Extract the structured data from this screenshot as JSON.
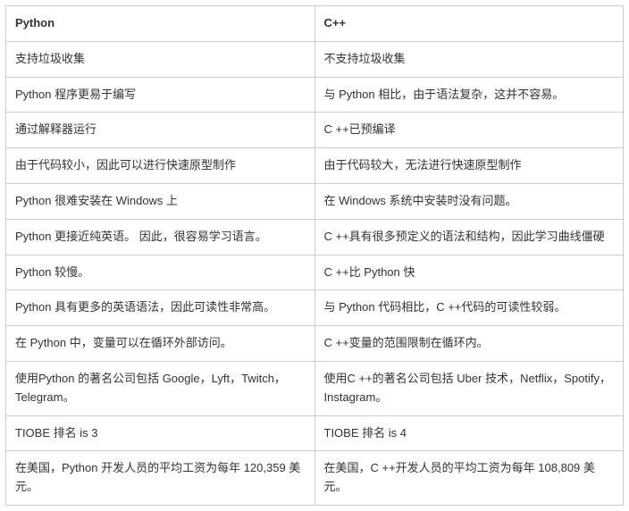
{
  "headers": {
    "left": "Python",
    "right": "C++"
  },
  "rows": [
    {
      "left": "支持垃圾收集",
      "right": "不支持垃圾收集"
    },
    {
      "left": "Python 程序更易于编写",
      "right": "与 Python 相比，由于语法复杂，这并不容易。"
    },
    {
      "left": "通过解释器运行",
      "right": "C ++已预编译"
    },
    {
      "left": "由于代码较小，因此可以进行快速原型制作",
      "right": "由于代码较大，无法进行快速原型制作"
    },
    {
      "left": "Python 很难安装在 Windows 上",
      "right": "在 Windows 系统中安装时没有问题。"
    },
    {
      "left": "Python 更接近纯英语。 因此，很容易学习语言。",
      "right": "C ++具有很多预定义的语法和结构，因此学习曲线僵硬"
    },
    {
      "left": "Python 较慢。",
      "right": "C ++比 Python 快"
    },
    {
      "left": "Python 具有更多的英语语法，因此可读性非常高。",
      "right": "与 Python 代码相比，C ++代码的可读性较弱。"
    },
    {
      "left": "在 Python 中，变量可以在循环外部访问。",
      "right": "C ++变量的范围限制在循环内。"
    },
    {
      "left": "使用Python 的著名公司包括 Google，Lyft，Twitch，Telegram。",
      "right": "使用C ++的著名公司包括 Uber 技术，Netflix，Spotify，Instagram。"
    },
    {
      "left": "TIOBE 排名 is 3",
      "right": "TIOBE 排名 is 4"
    },
    {
      "left": "在美国，Python 开发人员的平均工资为每年 120,359 美元。",
      "right": "在美国，C ++开发人员的平均工资为每年 108,809 美元。"
    }
  ],
  "chart_data": {
    "type": "table",
    "title": "Python vs C++ comparison",
    "columns": [
      "Python",
      "C++"
    ],
    "data": [
      [
        "支持垃圾收集",
        "不支持垃圾收集"
      ],
      [
        "Python 程序更易于编写",
        "与 Python 相比，由于语法复杂，这并不容易。"
      ],
      [
        "通过解释器运行",
        "C ++已预编译"
      ],
      [
        "由于代码较小，因此可以进行快速原型制作",
        "由于代码较大，无法进行快速原型制作"
      ],
      [
        "Python 很难安装在 Windows 上",
        "在 Windows 系统中安装时没有问题。"
      ],
      [
        "Python 更接近纯英语。 因此，很容易学习语言。",
        "C ++具有很多预定义的语法和结构，因此学习曲线僵硬"
      ],
      [
        "Python 较慢。",
        "C ++比 Python 快"
      ],
      [
        "Python 具有更多的英语语法，因此可读性非常高。",
        "与 Python 代码相比，C ++代码的可读性较弱。"
      ],
      [
        "在 Python 中，变量可以在循环外部访问。",
        "C ++变量的范围限制在循环内。"
      ],
      [
        "使用Python 的著名公司包括 Google，Lyft，Twitch，Telegram。",
        "使用C ++的著名公司包括 Uber 技术，Netflix，Spotify，Instagram。"
      ],
      [
        "TIOBE 排名 is 3",
        "TIOBE 排名 is 4"
      ],
      [
        "在美国，Python 开发人员的平均工资为每年 120,359 美元。",
        "在美国，C ++开发人员的平均工资为每年 108,809 美元。"
      ]
    ]
  }
}
